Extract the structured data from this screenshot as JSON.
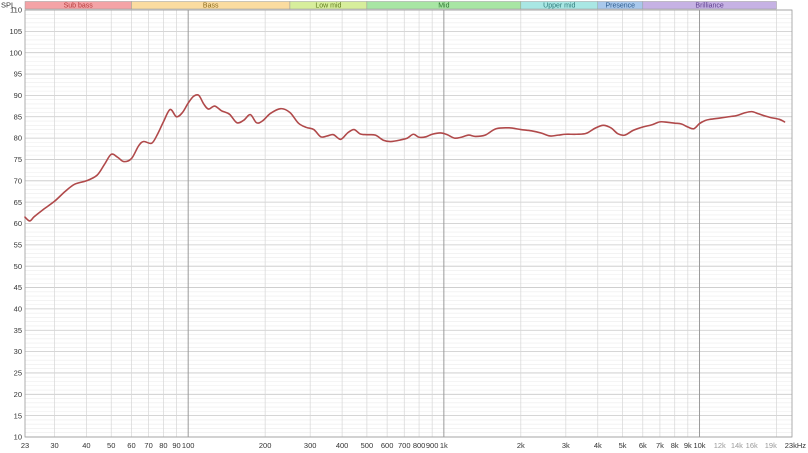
{
  "chart_data": {
    "type": "line",
    "title": "",
    "ylabel": "SPL",
    "xlabel": "",
    "x_scale": "log",
    "xlim": [
      23,
      23000
    ],
    "ylim": [
      10,
      110
    ],
    "grid": true,
    "y_ticks": [
      "10",
      "15",
      "20",
      "25",
      "30",
      "35",
      "40",
      "45",
      "50",
      "55",
      "60",
      "65",
      "70",
      "75",
      "80",
      "85",
      "90",
      "95",
      "100",
      "105",
      "110"
    ],
    "x_ticks": [
      {
        "f": 23,
        "label": "23"
      },
      {
        "f": 30,
        "label": "30"
      },
      {
        "f": 40,
        "label": "40"
      },
      {
        "f": 50,
        "label": "50"
      },
      {
        "f": 60,
        "label": "60"
      },
      {
        "f": 70,
        "label": "70"
      },
      {
        "f": 80,
        "label": "80"
      },
      {
        "f": 90,
        "label": "90"
      },
      {
        "f": 100,
        "label": "100"
      },
      {
        "f": 200,
        "label": "200"
      },
      {
        "f": 300,
        "label": "300"
      },
      {
        "f": 400,
        "label": "400"
      },
      {
        "f": 500,
        "label": "500"
      },
      {
        "f": 600,
        "label": "600"
      },
      {
        "f": 700,
        "label": "700"
      },
      {
        "f": 800,
        "label": "800"
      },
      {
        "f": 900,
        "label": "900"
      },
      {
        "f": 1000,
        "label": "1k"
      },
      {
        "f": 2000,
        "label": "2k"
      },
      {
        "f": 3000,
        "label": "3k"
      },
      {
        "f": 4000,
        "label": "4k"
      },
      {
        "f": 5000,
        "label": "5k"
      },
      {
        "f": 6000,
        "label": "6k"
      },
      {
        "f": 7000,
        "label": "7k"
      },
      {
        "f": 8000,
        "label": "8k"
      },
      {
        "f": 9000,
        "label": "9k"
      },
      {
        "f": 10000,
        "label": "10k"
      },
      {
        "f": 12000,
        "label": "12k",
        "light": true
      },
      {
        "f": 14000,
        "label": "14k",
        "light": true
      },
      {
        "f": 16000,
        "label": "16k",
        "light": true
      },
      {
        "f": 19000,
        "label": "19k",
        "light": true
      },
      {
        "f": 23000,
        "label": "23kHz"
      }
    ],
    "bands": [
      {
        "name": "Sub bass",
        "from": 23,
        "to": 60,
        "color": "#f4a3a6",
        "text": "#b53b3b"
      },
      {
        "name": "Bass",
        "from": 60,
        "to": 250,
        "color": "#fbdca0",
        "text": "#8a6a1c"
      },
      {
        "name": "Low mid",
        "from": 250,
        "to": 500,
        "color": "#d7ee9c",
        "text": "#5e7a1c"
      },
      {
        "name": "Mid",
        "from": 500,
        "to": 2000,
        "color": "#a8e6a4",
        "text": "#2f7a33"
      },
      {
        "name": "Upper mid",
        "from": 2000,
        "to": 4000,
        "color": "#a9e7e4",
        "text": "#2d7a79"
      },
      {
        "name": "Presence",
        "from": 4000,
        "to": 6000,
        "color": "#a9c8ec",
        "text": "#2d5c8e"
      },
      {
        "name": "Brilliance",
        "from": 6000,
        "to": 20000,
        "color": "#c6b2e4",
        "text": "#5d3f8e"
      }
    ],
    "series": [
      {
        "color": "#b0494a",
        "points": [
          [
            23,
            61.5
          ],
          [
            24,
            60.6
          ],
          [
            25,
            61.6
          ],
          [
            27,
            63.2
          ],
          [
            30,
            65.2
          ],
          [
            33,
            67.5
          ],
          [
            36,
            69.2
          ],
          [
            40,
            70.0
          ],
          [
            44,
            71.3
          ],
          [
            47,
            73.8
          ],
          [
            50,
            76.2
          ],
          [
            53,
            75.5
          ],
          [
            56,
            74.5
          ],
          [
            60,
            75.2
          ],
          [
            64,
            78.2
          ],
          [
            67,
            79.2
          ],
          [
            72,
            78.8
          ],
          [
            76,
            81.0
          ],
          [
            80,
            83.8
          ],
          [
            85,
            86.7
          ],
          [
            90,
            85.0
          ],
          [
            95,
            86.0
          ],
          [
            100,
            88.2
          ],
          [
            105,
            89.8
          ],
          [
            110,
            90.0
          ],
          [
            115,
            88.0
          ],
          [
            120,
            86.8
          ],
          [
            127,
            87.5
          ],
          [
            135,
            86.4
          ],
          [
            145,
            85.6
          ],
          [
            155,
            83.6
          ],
          [
            165,
            84.2
          ],
          [
            175,
            85.5
          ],
          [
            185,
            83.6
          ],
          [
            195,
            84.0
          ],
          [
            210,
            85.8
          ],
          [
            230,
            86.9
          ],
          [
            250,
            86.0
          ],
          [
            270,
            83.5
          ],
          [
            290,
            82.5
          ],
          [
            310,
            82.0
          ],
          [
            330,
            80.3
          ],
          [
            350,
            80.5
          ],
          [
            370,
            80.8
          ],
          [
            395,
            79.7
          ],
          [
            420,
            81.2
          ],
          [
            445,
            82.0
          ],
          [
            470,
            81.0
          ],
          [
            500,
            80.8
          ],
          [
            540,
            80.7
          ],
          [
            580,
            79.5
          ],
          [
            620,
            79.2
          ],
          [
            680,
            79.6
          ],
          [
            720,
            80.0
          ],
          [
            760,
            80.9
          ],
          [
            800,
            80.2
          ],
          [
            850,
            80.3
          ],
          [
            900,
            80.9
          ],
          [
            970,
            81.2
          ],
          [
            1030,
            80.8
          ],
          [
            1100,
            80.0
          ],
          [
            1170,
            80.2
          ],
          [
            1250,
            80.7
          ],
          [
            1330,
            80.4
          ],
          [
            1450,
            80.7
          ],
          [
            1600,
            82.2
          ],
          [
            1800,
            82.4
          ],
          [
            2000,
            82.0
          ],
          [
            2200,
            81.7
          ],
          [
            2400,
            81.2
          ],
          [
            2600,
            80.5
          ],
          [
            2800,
            80.7
          ],
          [
            3000,
            80.9
          ],
          [
            3300,
            80.9
          ],
          [
            3600,
            81.1
          ],
          [
            3900,
            82.3
          ],
          [
            4200,
            83.0
          ],
          [
            4500,
            82.4
          ],
          [
            4800,
            81.0
          ],
          [
            5100,
            80.7
          ],
          [
            5500,
            81.8
          ],
          [
            6000,
            82.6
          ],
          [
            6500,
            83.1
          ],
          [
            7000,
            83.8
          ],
          [
            7500,
            83.7
          ],
          [
            8000,
            83.5
          ],
          [
            8500,
            83.3
          ],
          [
            9000,
            82.6
          ],
          [
            9500,
            82.2
          ],
          [
            10000,
            83.4
          ],
          [
            10500,
            84.1
          ],
          [
            11000,
            84.4
          ],
          [
            12000,
            84.7
          ],
          [
            13000,
            85.0
          ],
          [
            14000,
            85.3
          ],
          [
            15000,
            85.9
          ],
          [
            16000,
            86.2
          ],
          [
            17000,
            85.7
          ],
          [
            18000,
            85.2
          ],
          [
            19000,
            84.8
          ],
          [
            20500,
            84.4
          ],
          [
            21500,
            83.8
          ]
        ]
      }
    ]
  }
}
